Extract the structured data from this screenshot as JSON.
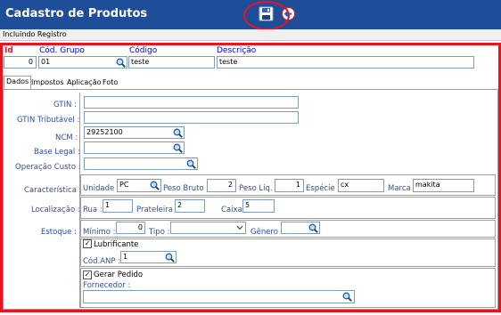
{
  "window": {
    "title": "Cadastro de Produtos"
  },
  "toolbar": {
    "save_icon": "save-icon",
    "exit_icon": "exit-icon"
  },
  "status": {
    "text": "Incluindo Registro"
  },
  "header": {
    "id_label": "Id",
    "id_value": "0",
    "grupo_label": "Cód. Grupo",
    "grupo_value": "01",
    "codigo_label": "Código",
    "codigo_value": "teste",
    "descricao_label": "Descrição",
    "descricao_value": "teste"
  },
  "tabs": [
    {
      "label": "Dados"
    },
    {
      "label": "Impostos"
    },
    {
      "label": "Aplicação"
    },
    {
      "label": "Foto"
    }
  ],
  "fields": {
    "gtin_label": "GTIN :",
    "gtin_value": "",
    "gtin_trib_label": "GTIN Tributável :",
    "gtin_trib_value": "",
    "ncm_label": "NCM :",
    "ncm_value": "29252100",
    "base_legal_label": "Base Legal :",
    "base_legal_value": "",
    "operacao_label": "Operação Custo :",
    "operacao_value": ""
  },
  "caracteristica": {
    "label": "Característica :",
    "unidade_label": "Unidade :",
    "unidade_value": "PC",
    "peso_bruto_label": "Peso Bruto :",
    "peso_bruto_value": "2",
    "peso_liq_label": "Peso Líq. :",
    "peso_liq_value": "1",
    "especie_label": "Espécie :",
    "especie_value": "cx",
    "marca_label": "Marca :",
    "marca_value": "makita"
  },
  "localizacao": {
    "label": "Localização :",
    "rua_label": "Rua :",
    "rua_value": "1",
    "prateleira_label": "Prateleira :",
    "prateleira_value": "2",
    "caixa_label": "Caixa :",
    "caixa_value": "5"
  },
  "estoque": {
    "label": "Estoque :",
    "minimo_label": "Mínimo :",
    "minimo_value": "0",
    "tipo_label": "Tipo :",
    "tipo_value": "",
    "genero_label": "Gênero :",
    "genero_value": ""
  },
  "lubrificante": {
    "checkbox_label": "Lubrificante",
    "checked": true,
    "cod_anp_label": "Cód.ANP :",
    "cod_anp_value": "1"
  },
  "pedido": {
    "checkbox_label": "Gerar Pedido",
    "checked": true,
    "fornecedor_label": "Fornecedor :",
    "fornecedor_value": ""
  },
  "colors": {
    "titlebar": "#1e4e99",
    "highlight": "#e8141c",
    "label_blue": "#2c4fa0",
    "label_red": "#e8141c"
  }
}
